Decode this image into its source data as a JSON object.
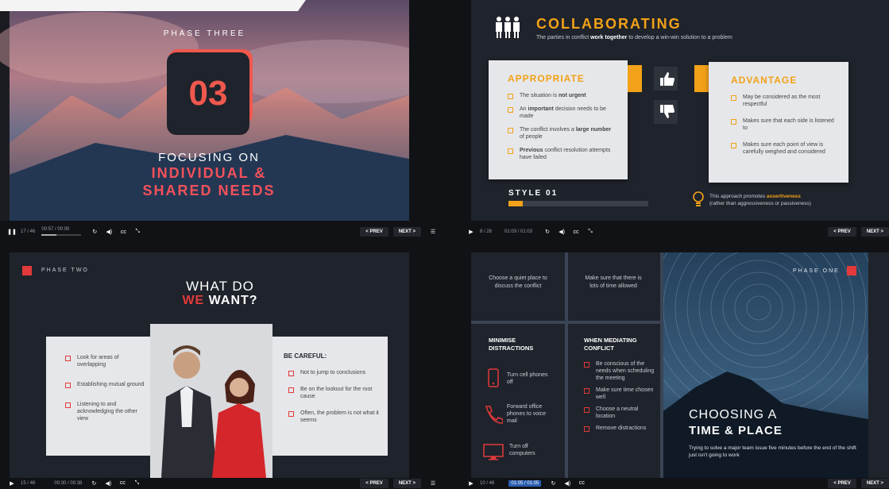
{
  "top_left": {
    "phase": "PHASE THREE",
    "number": "03",
    "line1": "FOCUSING ON",
    "line2": "INDIVIDUAL &",
    "line3": "SHARED NEEDS"
  },
  "top_right": {
    "title": "COLLABORATING",
    "subtitle_pre": "The parties in conflict ",
    "subtitle_bold": "work together",
    "subtitle_post": " to develop a win-win solution to a problem",
    "appropriate_title": "APPROPRIATE",
    "appropriate_items": [
      {
        "pre": "The situation is ",
        "bold": "not urgent",
        "post": ""
      },
      {
        "pre": "An ",
        "bold": "important",
        "post": " decision needs to be made"
      },
      {
        "pre": "The conflict involves a ",
        "bold": "large number",
        "post": " of people"
      },
      {
        "pre": "",
        "bold": "Previous",
        "post": " conflict resolution attempts have failed"
      }
    ],
    "advantage_title": "ADVANTAGE",
    "advantage_items": [
      "May be considered as the most respectful",
      "Makes sure that each side is listened to",
      "Makes sure each point of view is carefully weighed and considered"
    ],
    "style_label": "STYLE 01",
    "style_progress": 0.1,
    "note_pre": "This approach promotes ",
    "note_bold": "assertiveness",
    "note_post": "(rather than aggressiveness or passiveness)"
  },
  "bottom_left": {
    "phase": "PHASE TWO",
    "title1": "WHAT DO",
    "title2a": "WE",
    "title2b": " WANT?",
    "left_items": [
      "Look for areas of overlapping",
      "Establishing mutual ground",
      "Listening to and acknowledging the other view"
    ],
    "careful_title": "BE CAREFUL:",
    "right_items": [
      "Not to jump to conclusions",
      "Be on the lookout for the root cause",
      "Often, the problem is not what it seems"
    ]
  },
  "bottom_right": {
    "cell1": "Choose a quiet place to discuss the conflict",
    "cell2": "Make sure that there is lots of time allowed",
    "minimise_title": "MINIMISE DISTRACTIONS",
    "minimise_items": [
      "Turn cell phones off",
      "Forward office phones to voice mail",
      "Turn off computers"
    ],
    "mediating_title": "WHEN MEDIATING CONFLICT",
    "mediating_items": [
      "Be conscious of the needs when scheduling the meeting",
      "Make sure time chosen well",
      "Choose a neutral location",
      "Remove distractions"
    ],
    "phase": "PHASE ONE",
    "title1": "CHOOSING A",
    "title2": "TIME & PLACE",
    "caption": "Trying to solve a major team issue five minutes before the end of the shift just isn't going to work"
  },
  "players": {
    "top_left": {
      "slide": "17 / 46",
      "time": "00:57 / 00:00",
      "progress": 0.37
    },
    "top_right": {
      "slide": "8 / 28",
      "time": "01:03 / 01:03"
    },
    "bottom_left": {
      "slide": "15 / 46",
      "time": "00:30 / 00:38"
    },
    "bottom_right": {
      "slide": "10 / 46",
      "time": "01:05 / 01:05"
    },
    "prev_label": "< PREV",
    "next_label": "NEXT >"
  },
  "colors": {
    "accent_red": "#e23a3a",
    "accent_orange": "#f2a118",
    "dark_bg": "#1f232b"
  }
}
